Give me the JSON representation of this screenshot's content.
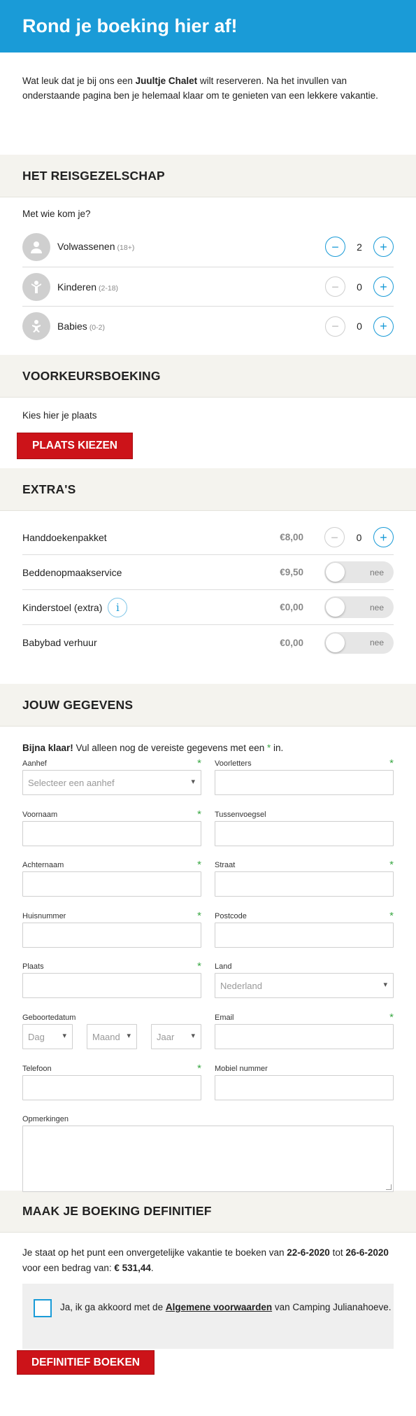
{
  "header": {
    "title": "Rond je boeking hier af!"
  },
  "intro": {
    "text_before": "Wat leuk dat je bij ons een ",
    "brand": "Juultje Chalet",
    "text_after": " wilt reserveren. Na het invullen van onderstaande pagina ben je helemaal klaar om te genieten van een lekkere vakantie."
  },
  "party": {
    "heading": "HET REISGEZELSCHAP",
    "question": "Met wie kom je?",
    "rows": [
      {
        "label": "Volwassenen",
        "age": "(18+)",
        "value": "2",
        "icon": "adult-icon",
        "minus_enabled": true
      },
      {
        "label": "Kinderen",
        "age": "(2-18)",
        "value": "0",
        "icon": "child-icon",
        "minus_enabled": false
      },
      {
        "label": "Babies",
        "age": "(0-2)",
        "value": "0",
        "icon": "baby-icon",
        "minus_enabled": false
      }
    ],
    "minus": "−",
    "plus": "+"
  },
  "preference": {
    "heading": "VOORKEURSBOEKING",
    "text": "Kies hier je plaats",
    "button": "PLAATS KIEZEN"
  },
  "extras": {
    "heading": "EXTRA'S",
    "rows": [
      {
        "label": "Handdoekenpakket",
        "price": "€8,00",
        "control": "stepper",
        "value": "0"
      },
      {
        "label": "Beddenopmaakservice",
        "price": "€9,50",
        "control": "toggle",
        "value": "nee"
      },
      {
        "label": "Kinderstoel (extra)",
        "price": "€0,00",
        "control": "toggle",
        "value": "nee",
        "info": "i"
      },
      {
        "label": "Babybad verhuur",
        "price": "€0,00",
        "control": "toggle",
        "value": "nee"
      }
    ]
  },
  "details": {
    "heading": "JOUW GEGEVENS",
    "intro_bold": "Bijna klaar!",
    "intro_text": " Vul alleen nog de vereiste gegevens met een ",
    "intro_star": "*",
    "intro_end": " in.",
    "required_mark": "*",
    "fields": {
      "aanhef": {
        "label": "Aanhef",
        "placeholder": "Selecteer een aanhef"
      },
      "voorletters": {
        "label": "Voorletters"
      },
      "voornaam": {
        "label": "Voornaam"
      },
      "tussenvoegsel": {
        "label": "Tussenvoegsel"
      },
      "achternaam": {
        "label": "Achternaam"
      },
      "straat": {
        "label": "Straat"
      },
      "huisnummer": {
        "label": "Huisnummer"
      },
      "postcode": {
        "label": "Postcode"
      },
      "plaats": {
        "label": "Plaats"
      },
      "land": {
        "label": "Land",
        "value": "Nederland"
      },
      "geboortedatum": {
        "label": "Geboortedatum",
        "dag": "Dag",
        "maand": "Maand",
        "jaar": "Jaar"
      },
      "email": {
        "label": "Email"
      },
      "telefoon": {
        "label": "Telefoon"
      },
      "mobiel": {
        "label": "Mobiel nummer"
      },
      "opmerkingen": {
        "label": "Opmerkingen"
      }
    }
  },
  "final": {
    "heading": "MAAK JE BOEKING DEFINITIEF",
    "text_1": "Je staat op het punt een onvergetelijke vakantie te boeken van ",
    "date_from": "22-6-2020",
    "text_2": " tot ",
    "date_to": "26-6-2020",
    "text_3": " voor een bedrag van: ",
    "amount": "€ 531,44",
    "text_4": ".",
    "terms_before": "Ja, ik ga akkoord met de ",
    "terms_link": "Algemene voorwaarden",
    "terms_after": " van Camping Julianahoeve.",
    "button": "DEFINITIEF BOEKEN"
  },
  "colors": {
    "brand_blue": "#1a9bd7",
    "button_red": "#cc1319",
    "section_bg": "#f4f3ee",
    "required_green": "#3aa844"
  }
}
